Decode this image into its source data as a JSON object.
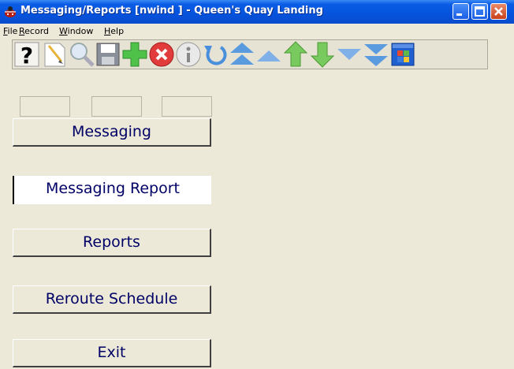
{
  "window": {
    "title": "Messaging/Reports [nwind   ] - Queen's Quay Landing",
    "icon": "ladybug-app-icon",
    "controls": [
      "minimize",
      "maximize",
      "close"
    ]
  },
  "menu": [
    {
      "u": "F",
      "rest": "ile"
    },
    {
      "u": "R",
      "rest": "ecord"
    },
    {
      "u": "W",
      "rest": "indow"
    },
    {
      "u": "H",
      "rest": "elp"
    }
  ],
  "toolbar": {
    "buttons": [
      "help-icon",
      "new-icon",
      "find-icon",
      "save-icon",
      "add-icon",
      "delete-icon",
      "info-icon",
      "undo-icon",
      "first-record-icon",
      "previous-page-icon",
      "previous-record-icon",
      "next-record-icon",
      "next-page-icon",
      "last-record-icon",
      "windows-icon"
    ]
  },
  "fields": [
    "",
    "",
    ""
  ],
  "buttons": {
    "messaging": "Messaging",
    "messaging_report": "Messaging Report",
    "reports": "Reports",
    "reroute_schedule": "Reroute Schedule",
    "exit": "Exit"
  },
  "colors": {
    "title_bar": "#0553dd",
    "button_text": "#000066",
    "background": "#ece9d8"
  }
}
